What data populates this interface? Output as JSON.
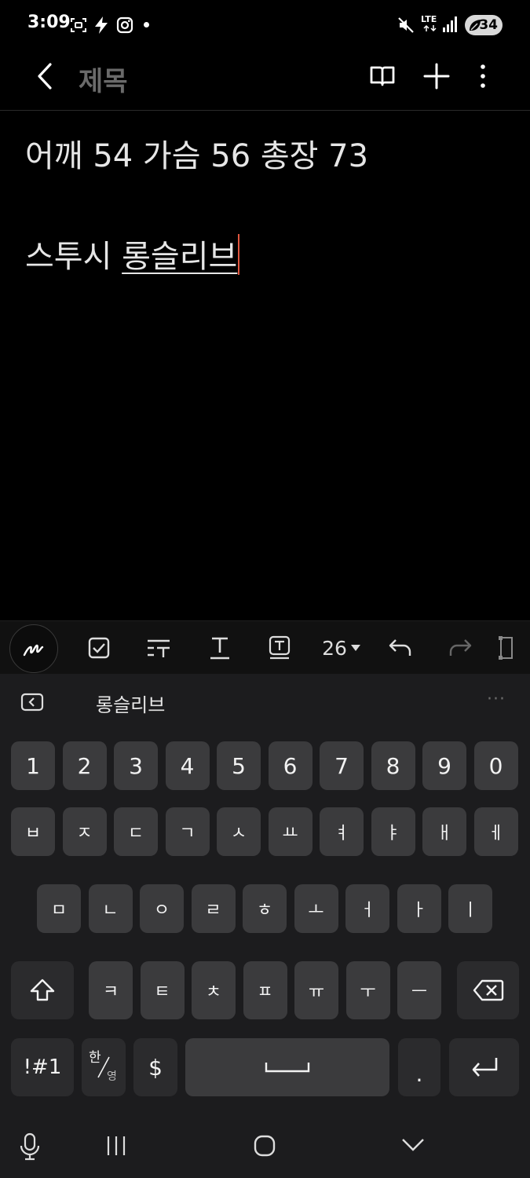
{
  "status_bar": {
    "time": "3:09",
    "network": "LTE",
    "battery": "34"
  },
  "app_bar": {
    "title": "제목"
  },
  "note": {
    "line1": "어깨 54 가슴 56 총장 73",
    "line2_prefix": "스투시 ",
    "line2_composing": "롱슬리브"
  },
  "toolbar": {
    "font_size": "26"
  },
  "suggestion": {
    "word": "롱슬리브",
    "more": "···"
  },
  "keyboard": {
    "row_numbers": [
      "1",
      "2",
      "3",
      "4",
      "5",
      "6",
      "7",
      "8",
      "9",
      "0"
    ],
    "row1": [
      "ㅂ",
      "ㅈ",
      "ㄷ",
      "ㄱ",
      "ㅅ",
      "ㅛ",
      "ㅕ",
      "ㅑ",
      "ㅐ",
      "ㅔ"
    ],
    "row2": [
      "ㅁ",
      "ㄴ",
      "ㅇ",
      "ㄹ",
      "ㅎ",
      "ㅗ",
      "ㅓ",
      "ㅏ",
      "ㅣ"
    ],
    "row3": [
      "ㅋ",
      "ㅌ",
      "ㅊ",
      "ㅍ",
      "ㅠ",
      "ㅜ",
      "ㅡ"
    ],
    "symbols_label": "!#1",
    "lang_top": "한",
    "lang_bottom": "영",
    "currency_label": "$",
    "period_label": "."
  },
  "colors": {
    "background": "#000000",
    "keyboard_bg": "#1c1c1e",
    "key": "#3b3b3d",
    "cursor": "#e0563f"
  }
}
